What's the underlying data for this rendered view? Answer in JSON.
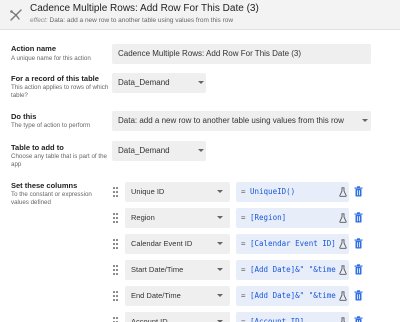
{
  "header": {
    "title": "Cadence Multiple Rows: Add Row For This Date (3)",
    "effect_prefix": "effect:",
    "effect_text": "Data: add a new row to another table using values from this row"
  },
  "action_name": {
    "label": "Action name",
    "help": "A unique name for this action",
    "value": "Cadence Multiple Rows: Add Row For This Date (3)"
  },
  "table": {
    "label": "For a record of this table",
    "help": "This action applies to rows of which table?",
    "value": "Data_Demand"
  },
  "do_this": {
    "label": "Do this",
    "help": "The type of action to perform",
    "value": "Data: add a new row to another table using values from this row"
  },
  "table_to_add": {
    "label": "Table to add to",
    "help": "Choose any table that is part of the app",
    "value": "Data_Demand"
  },
  "set_columns": {
    "label": "Set these columns",
    "help": "To the constant or expression values defined",
    "rows": [
      {
        "column": "Unique ID",
        "eq": "=",
        "expression": "UniqueID()"
      },
      {
        "column": "Region",
        "eq": "=",
        "expression": "[Region]"
      },
      {
        "column": "Calendar Event ID",
        "eq": "=",
        "expression": "[Calendar Event ID]"
      },
      {
        "column": "Start Date/Time",
        "eq": "=",
        "expression": "[Add Date]&\" \"&time"
      },
      {
        "column": "End Date/Time",
        "eq": "=",
        "expression": "[Add Date]&\" \"&time"
      },
      {
        "column": "Account ID",
        "eq": "=",
        "expression": "[Account ID]"
      }
    ]
  },
  "colors": {
    "accent": "#1a56db",
    "expression_bg": "#e8eef9",
    "field_bg": "#efefef"
  },
  "icons": {
    "header": "action-icon",
    "row_drag": "drag-handle-icon",
    "row_expression_editor": "flask-icon",
    "row_delete": "trash-icon",
    "dropdown": "chevron-down-icon"
  }
}
